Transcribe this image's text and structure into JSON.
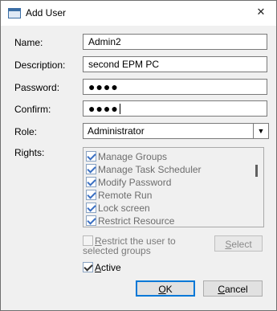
{
  "window": {
    "title": "Add User",
    "close_glyph": "✕"
  },
  "form": {
    "name": {
      "label": "Name:",
      "value": "Admin2"
    },
    "description": {
      "label": "Description:",
      "value": "second EPM PC"
    },
    "password": {
      "label": "Password:",
      "value": "●●●●"
    },
    "confirm": {
      "label": "Confirm:",
      "value": "●●●●"
    },
    "role": {
      "label": "Role:",
      "value": "Administrator"
    },
    "rights": {
      "label": "Rights:",
      "items": [
        {
          "label": "Manage Groups",
          "checked": true
        },
        {
          "label": "Manage Task Scheduler",
          "checked": true
        },
        {
          "label": "Modify Password",
          "checked": true
        },
        {
          "label": "Remote Run",
          "checked": true
        },
        {
          "label": "Lock screen",
          "checked": true
        },
        {
          "label": "Restrict Resource",
          "checked": true
        }
      ]
    },
    "restrict": {
      "label_prefix": "R",
      "label_rest": "estrict the user to selected groups",
      "checked": false
    },
    "select_button": {
      "prefix": "S",
      "rest": "elect"
    },
    "active": {
      "prefix": "A",
      "rest": "ctive",
      "checked": true
    }
  },
  "buttons": {
    "ok": {
      "prefix": "O",
      "rest": "K"
    },
    "cancel": {
      "prefix": "C",
      "rest": "ancel"
    }
  },
  "icons": {
    "close": "close-icon",
    "dropdown": "chevron-down-icon",
    "app": "window-icon"
  }
}
